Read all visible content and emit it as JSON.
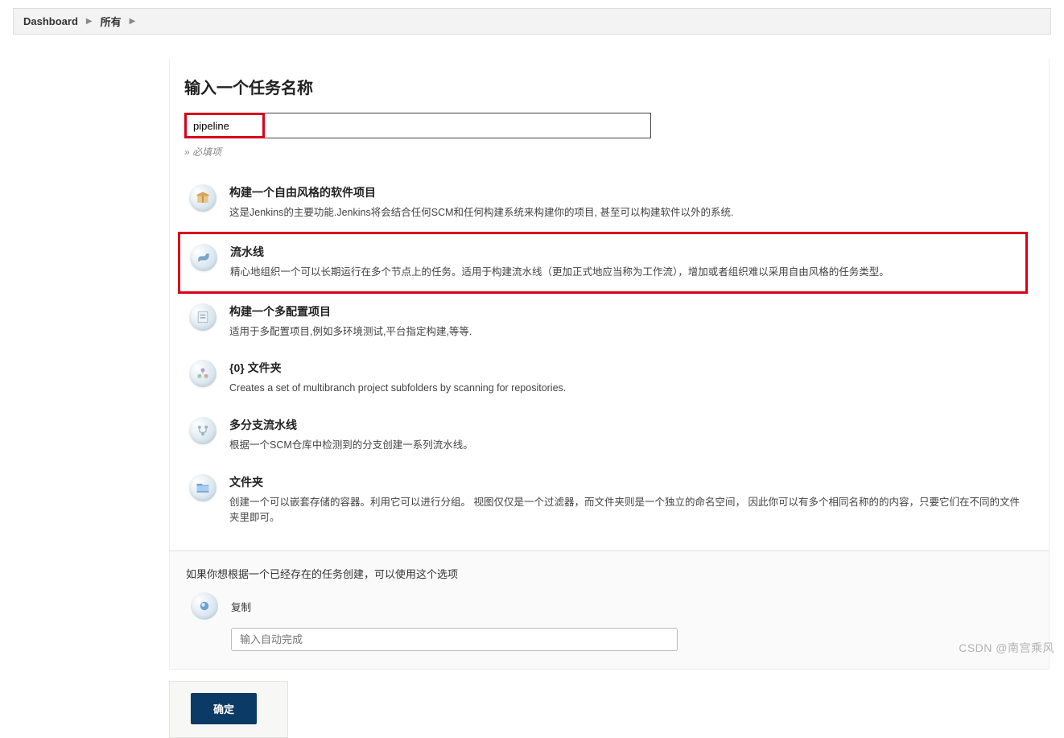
{
  "breadcrumb": {
    "items": [
      "Dashboard",
      "所有"
    ]
  },
  "form": {
    "title": "输入一个任务名称",
    "name_value": "pipeline",
    "required_text": "» 必填项"
  },
  "items": [
    {
      "icon": "box-icon",
      "title": "构建一个自由风格的软件项目",
      "desc": "这是Jenkins的主要功能.Jenkins将会结合任何SCM和任何构建系统来构建你的项目, 甚至可以构建软件以外的系统."
    },
    {
      "icon": "pipeline-icon",
      "title": "流水线",
      "desc": "精心地组织一个可以长期运行在多个节点上的任务。适用于构建流水线（更加正式地应当称为工作流），增加或者组织难以采用自由风格的任务类型。",
      "highlight": true
    },
    {
      "icon": "multiconfig-icon",
      "title": "构建一个多配置项目",
      "desc": "适用于多配置项目,例如多环境测试,平台指定构建,等等."
    },
    {
      "icon": "org-folder-icon",
      "title": "{0} 文件夹",
      "desc": "Creates a set of multibranch project subfolders by scanning for repositories."
    },
    {
      "icon": "multibranch-icon",
      "title": "多分支流水线",
      "desc": "根据一个SCM仓库中检测到的分支创建一系列流水线。"
    },
    {
      "icon": "folder-icon",
      "title": "文件夹",
      "desc": "创建一个可以嵌套存储的容器。利用它可以进行分组。 视图仅仅是一个过滤器，而文件夹则是一个独立的命名空间， 因此你可以有多个相同名称的的内容，只要它们在不同的文件 夹里即可。"
    }
  ],
  "copy": {
    "hint": "如果你想根据一个已经存在的任务创建，可以使用这个选项",
    "label": "复制",
    "placeholder": "输入自动完成"
  },
  "footer": {
    "ok_label": "确定"
  },
  "watermark": "CSDN @南宫乘风"
}
